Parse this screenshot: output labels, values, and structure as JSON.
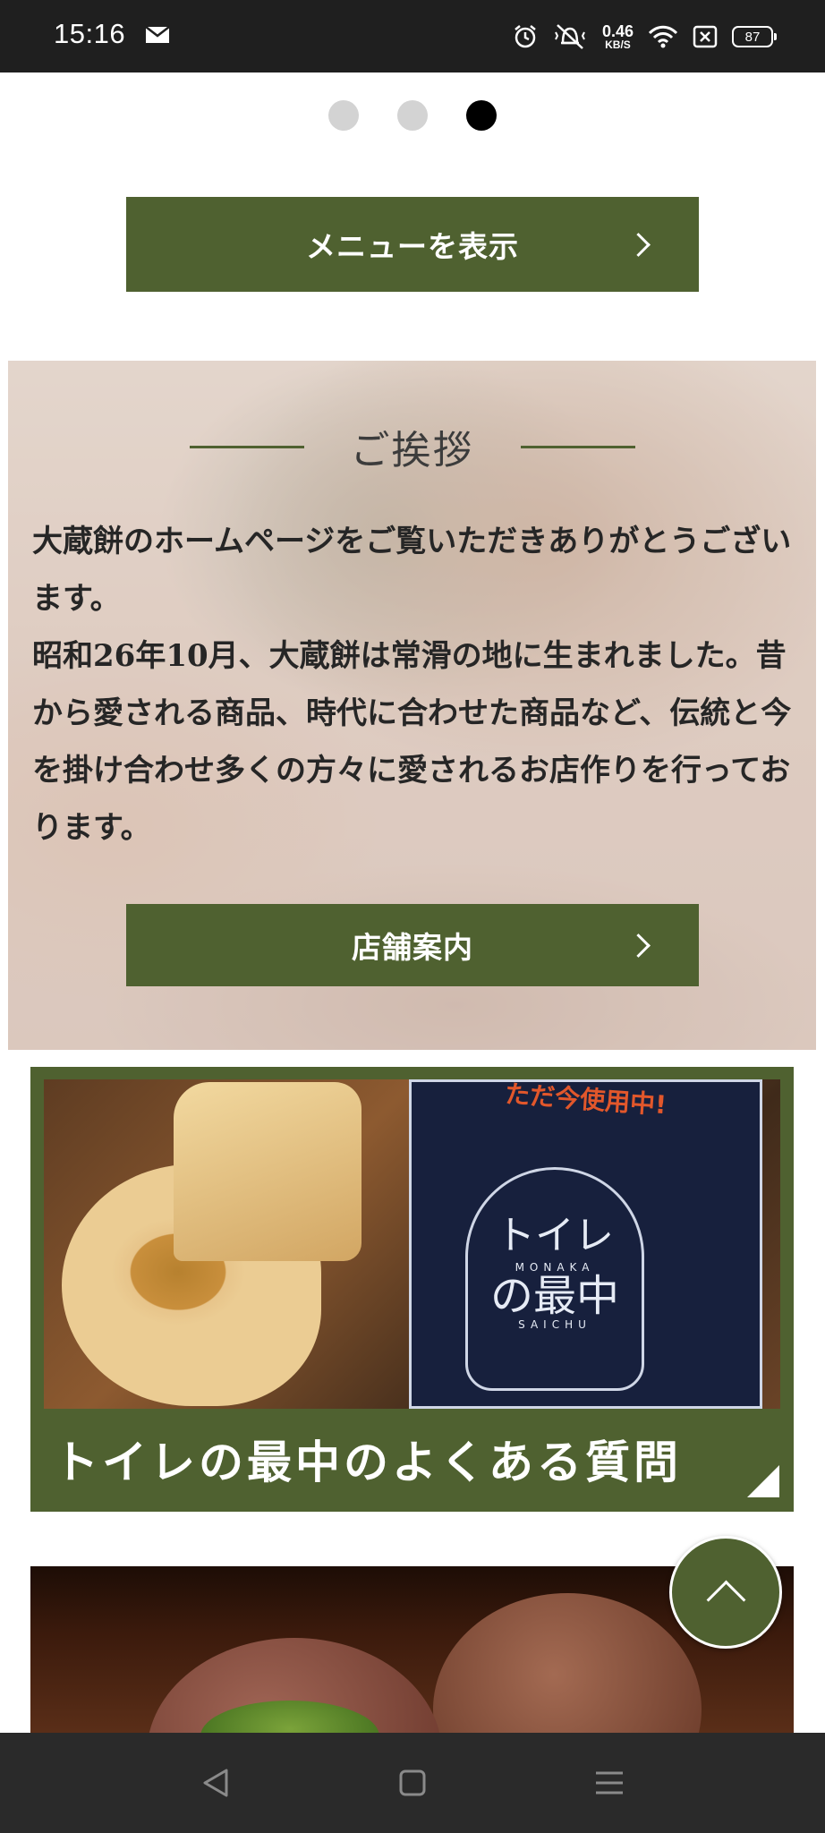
{
  "status_bar": {
    "time": "15:16",
    "net_speed_value": "0.46",
    "net_speed_unit": "KB/S",
    "battery": "87",
    "icons": [
      "mail-icon",
      "alarm-icon",
      "vibrate-icon",
      "wifi-icon",
      "sim-off-icon",
      "battery-icon"
    ]
  },
  "carousel": {
    "dot_count": 3,
    "active_index": 2
  },
  "menu_button": {
    "label": "メニューを表示"
  },
  "greeting": {
    "title": "ご挨拶",
    "body": "大蔵餅のホームページをご覧いただきありがとうございます。\n昭和26年10月、大蔵餅は常滑の地に生まれました。昔から愛される商品、時代に合わせた商品など、伝統と今を掛け合わせ多くの方々に愛されるお店作りを行っております。",
    "button_label": "店舗案内"
  },
  "faq_banner": {
    "caption": "トイレの最中のよくある質問",
    "photo_text_top": "ただ今使用中!",
    "logo_line1": "トイレ",
    "logo_line2": "MONAKA",
    "logo_line3": "の最中",
    "logo_line4": "SAICHU"
  },
  "colors": {
    "accent_green": "#4f6130",
    "status_bar_bg": "#1f1f1f",
    "nav_bar_bg": "#2a2a2a"
  },
  "nav_bar": {
    "buttons": [
      "back-icon",
      "home-icon",
      "menu-icon"
    ]
  }
}
